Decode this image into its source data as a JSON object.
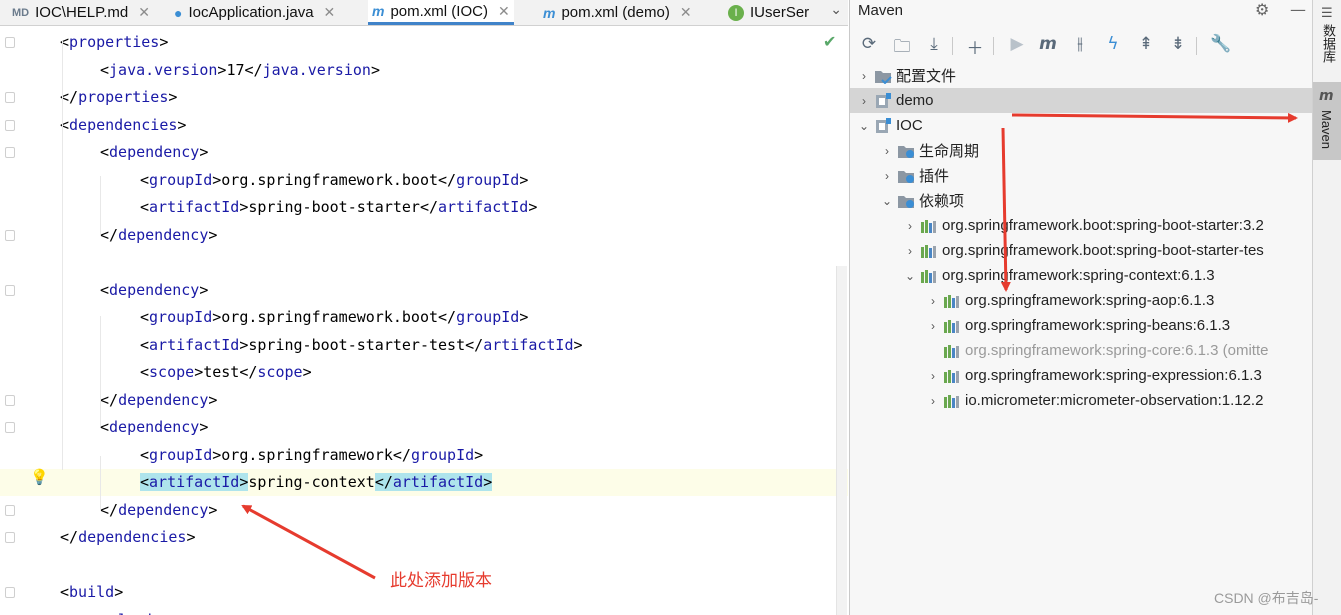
{
  "tabs": [
    {
      "label": "IOC\\HELP.md",
      "icon": "markdown-icon",
      "active": false
    },
    {
      "label": "IocApplication.java",
      "icon": "java-class-icon",
      "active": false
    },
    {
      "label": "pom.xml (IOC)",
      "icon": "maven-icon",
      "active": true
    },
    {
      "label": "pom.xml (demo)",
      "icon": "maven-icon",
      "active": false
    },
    {
      "label": "IUserSer",
      "icon": "interface-icon",
      "active": false
    }
  ],
  "editor": {
    "lines": [
      {
        "indent": 1,
        "open": "properties"
      },
      {
        "indent": 2,
        "open": "java.version",
        "text": "17",
        "close": "java.version"
      },
      {
        "indent": 1,
        "close": "properties"
      },
      {
        "indent": 1,
        "open": "dependencies"
      },
      {
        "indent": 2,
        "open": "dependency"
      },
      {
        "indent": 3,
        "open": "groupId",
        "text": "org.springframework.boot",
        "close": "groupId"
      },
      {
        "indent": 3,
        "open": "artifactId",
        "text": "spring-boot-starter",
        "close": "artifactId"
      },
      {
        "indent": 2,
        "close": "dependency"
      },
      {
        "indent": 0
      },
      {
        "indent": 2,
        "open": "dependency"
      },
      {
        "indent": 3,
        "open": "groupId",
        "text": "org.springframework.boot",
        "close": "groupId"
      },
      {
        "indent": 3,
        "open": "artifactId",
        "text": "spring-boot-starter-test",
        "close": "artifactId"
      },
      {
        "indent": 3,
        "open": "scope",
        "text": "test",
        "close": "scope"
      },
      {
        "indent": 2,
        "close": "dependency"
      },
      {
        "indent": 2,
        "open": "dependency"
      },
      {
        "indent": 3,
        "open": "groupId",
        "text": "org.springframework",
        "close": "groupId"
      },
      {
        "indent": 3,
        "open": "artifactId",
        "text": "spring-context",
        "close": "artifactId",
        "highlight": true
      },
      {
        "indent": 2,
        "close": "dependency"
      },
      {
        "indent": 1,
        "close": "dependencies"
      },
      {
        "indent": 0
      },
      {
        "indent": 1,
        "open": "build"
      },
      {
        "indent": 2,
        "open": "plugins"
      }
    ]
  },
  "annotation": {
    "text": "此处添加版本"
  },
  "maven": {
    "title": "Maven",
    "toolbar": [
      "reload-icon",
      "add-folder-icon",
      "download-icon",
      "plus-icon",
      "run-icon",
      "maven-goal-icon",
      "skip-tests-icon",
      "lightning-icon",
      "expand-all-icon",
      "collapse-all-icon",
      "wrench-icon"
    ],
    "tree": [
      {
        "level": 0,
        "arrow": "›",
        "icon": "folder-config-icon",
        "label": "配置文件"
      },
      {
        "level": 0,
        "arrow": "›",
        "icon": "maven-module-icon",
        "label": "demo",
        "selected": true
      },
      {
        "level": 0,
        "arrow": "⌄",
        "icon": "maven-module-icon",
        "label": "IOC"
      },
      {
        "level": 1,
        "arrow": "›",
        "icon": "lifecycle-folder-icon",
        "label": "生命周期"
      },
      {
        "level": 1,
        "arrow": "›",
        "icon": "plugins-folder-icon",
        "label": "插件"
      },
      {
        "level": 1,
        "arrow": "⌄",
        "icon": "dependencies-folder-icon",
        "label": "依赖项"
      },
      {
        "level": 2,
        "arrow": "›",
        "icon": "library-icon",
        "label": "org.springframework.boot:spring-boot-starter:3.2"
      },
      {
        "level": 2,
        "arrow": "›",
        "icon": "library-icon",
        "label": "org.springframework.boot:spring-boot-starter-tes"
      },
      {
        "level": 2,
        "arrow": "⌄",
        "icon": "library-icon",
        "label": "org.springframework:spring-context:6.1.3"
      },
      {
        "level": 3,
        "arrow": "›",
        "icon": "library-icon",
        "label": "org.springframework:spring-aop:6.1.3"
      },
      {
        "level": 3,
        "arrow": "›",
        "icon": "library-icon",
        "label": "org.springframework:spring-beans:6.1.3"
      },
      {
        "level": 3,
        "arrow": "",
        "icon": "library-icon",
        "label": "org.springframework:spring-core:6.1.3 (omitte",
        "dim": true
      },
      {
        "level": 3,
        "arrow": "›",
        "icon": "library-icon",
        "label": "org.springframework:spring-expression:6.1.3"
      },
      {
        "level": 3,
        "arrow": "›",
        "icon": "library-icon",
        "label": "io.micrometer:micrometer-observation:1.12.2"
      }
    ]
  },
  "right_strip": {
    "database_label": "数据库",
    "maven_label": "Maven"
  },
  "watermark": "CSDN @布吉岛-",
  "colors": {
    "accent": "#4083c9",
    "tag": "#1a1aa6",
    "annotation": "#e63b2e"
  }
}
